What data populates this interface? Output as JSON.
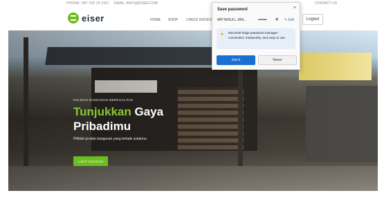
{
  "topbar": {
    "phone": "PHONE: 087 236 20 233",
    "separator": "|",
    "email": "EMAIL: INFO@EISER.COM",
    "right": "CONTACT US"
  },
  "brand": {
    "name": "eiser",
    "color": "#6cbd1e"
  },
  "nav": {
    "home": "HOME",
    "shop": "SHOP",
    "checkout": "CHECK INVOICE",
    "logout": "Logout"
  },
  "hero": {
    "eyebrow": "KOLEKSI BANGUNAN BERKUALITAS",
    "headline_green": "Tunjukkan",
    "headline_white": " Gaya",
    "headline_line2": "Pribadimu",
    "subline": "Pilihlah produk bangunan yang terbaik untukmu.",
    "cta": "LIHAT KOLEKSI"
  },
  "password_popup": {
    "title": "Save password",
    "close": "×",
    "username": "MIFTAHULL JAN...",
    "password_mask": "••••••••••",
    "eye_icon": "◉",
    "edit": "✎ Edit",
    "info_icon": "lightbulb-icon",
    "info_text": "Microsoft Edge password manager- convenient, trustworthy, and easy to use",
    "got_it": "Got it",
    "never": "Never",
    "accent": "#1a6fd0"
  }
}
